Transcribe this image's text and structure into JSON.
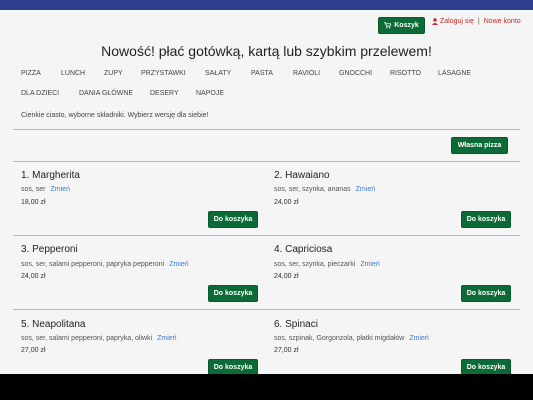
{
  "header": {
    "cart_label": "Koszyk",
    "login_label": "Zaloguj się",
    "separator": "|",
    "register_label": "Nowe konto"
  },
  "headline": "Nowość! płać gotówką, kartą lub szybkim przelewem!",
  "nav": [
    "PIZZA",
    "LUNCH",
    "ZUPY",
    "PRZYSTAWKI",
    "SAŁATY",
    "PASTA",
    "RAVIOLI",
    "GNOCCHI",
    "RISOTTO",
    "LASAGNE",
    "DLA DZIECI",
    "DANIA GŁÓWNE",
    "DESERY",
    "NAPOJE"
  ],
  "intro": "Cienkie ciasto, wyborne składniki. Wybierz wersję dla siebie!",
  "own_pizza_label": "Własna pizza",
  "change_label": "Zmień",
  "add_label": "Do koszyka",
  "pizzas": [
    {
      "name": "1. Margherita",
      "ingredients": "sos, ser",
      "price": "18,00 zł"
    },
    {
      "name": "2. Hawaiano",
      "ingredients": "sos, ser, szynka, ananas",
      "price": "24,00 zł"
    },
    {
      "name": "3. Pepperoni",
      "ingredients": "sos, ser, salami pepperoni, papryka pepperoni",
      "price": "24,00 zł"
    },
    {
      "name": "4. Capriciosa",
      "ingredients": "sos, ser, szynka, pieczarki",
      "price": "24,00 zł"
    },
    {
      "name": "5. Neapolitana",
      "ingredients": "sos, ser, salami pepperoni, papryka, oliwki",
      "price": "27,00 zł"
    },
    {
      "name": "6. Spinaci",
      "ingredients": "sos, szpinak, Gorgonzola, płatki migdałów",
      "price": "27,00 zł"
    }
  ],
  "colors": {
    "accent": "#0b6a35",
    "top_bar": "#2e3f8f",
    "divider": "#e3a597",
    "link": "#3a7bd5",
    "account": "#c62828"
  },
  "icons": {
    "cart": "cart-icon",
    "user": "user-icon"
  }
}
